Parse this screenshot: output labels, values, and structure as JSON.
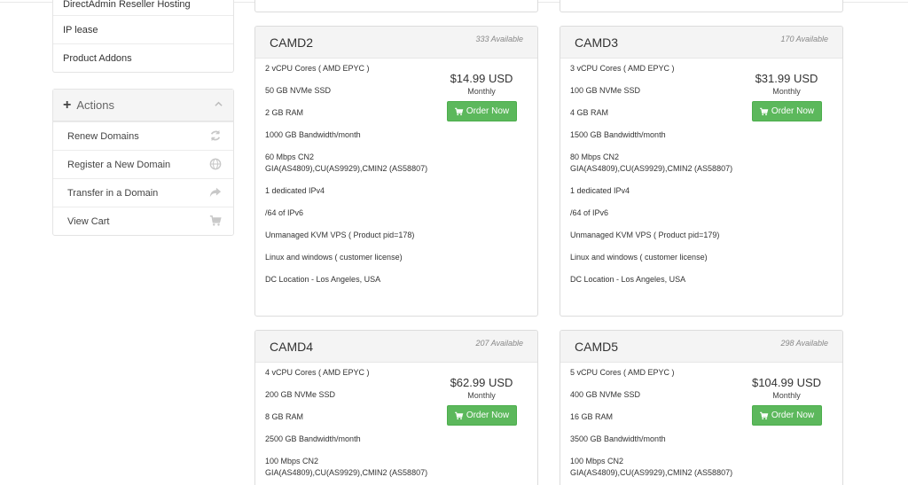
{
  "sidebar": {
    "items": [
      {
        "label": "DirectAdmin Reseller Hosting"
      },
      {
        "label": "IP lease"
      },
      {
        "label": "Product Addons"
      }
    ]
  },
  "actions": {
    "title": "Actions",
    "items": [
      {
        "label": "Renew Domains",
        "icon": "refresh-icon"
      },
      {
        "label": "Register a New Domain",
        "icon": "globe-icon"
      },
      {
        "label": "Transfer in a Domain",
        "icon": "share-icon"
      },
      {
        "label": "View Cart",
        "icon": "cart-icon"
      }
    ]
  },
  "products": [
    {
      "name": "CAMD2",
      "available": "333 Available",
      "price": "$14.99 USD",
      "cycle": "Monthly",
      "order_label": "Order Now",
      "features": [
        "2 vCPU Cores ( AMD EPYC )",
        "50 GB NVMe SSD",
        "2 GB RAM",
        "1000 GB Bandwidth/month",
        "60 Mbps CN2 GIA(AS4809),CU(AS9929),CMIN2 (AS58807)",
        "1 dedicated IPv4",
        "/64 of IPv6",
        "Unmanaged KVM VPS ( Product pid=178)",
        "Linux and windows ( customer license)",
        "DC Location - Los Angeles, USA"
      ]
    },
    {
      "name": "CAMD3",
      "available": "170 Available",
      "price": "$31.99 USD",
      "cycle": "Monthly",
      "order_label": "Order Now",
      "features": [
        "3 vCPU Cores ( AMD EPYC )",
        "100 GB NVMe SSD",
        "4 GB RAM",
        "1500 GB Bandwidth/month",
        "80 Mbps CN2 GIA(AS4809),CU(AS9929),CMIN2 (AS58807)",
        "1 dedicated IPv4",
        "/64 of IPv6",
        "Unmanaged KVM VPS ( Product pid=179)",
        "Linux and windows ( customer license)",
        "DC Location - Los Angeles, USA"
      ]
    },
    {
      "name": "CAMD4",
      "available": "207 Available",
      "price": "$62.99 USD",
      "cycle": "Monthly",
      "order_label": "Order Now",
      "features": [
        "4 vCPU Cores ( AMD EPYC )",
        "200 GB NVMe SSD",
        "8 GB RAM",
        "2500 GB Bandwidth/month",
        "100 Mbps CN2 GIA(AS4809),CU(AS9929),CMIN2 (AS58807)"
      ]
    },
    {
      "name": "CAMD5",
      "available": "298 Available",
      "price": "$104.99 USD",
      "cycle": "Monthly",
      "order_label": "Order Now",
      "features": [
        "5 vCPU Cores ( AMD EPYC )",
        "400 GB NVMe SSD",
        "16 GB RAM",
        "3500 GB Bandwidth/month",
        "100 Mbps CN2 GIA(AS4809),CU(AS9929),CMIN2 (AS58807)"
      ]
    }
  ],
  "colors": {
    "order_button": "#5cb85c",
    "panel_header": "#f4f4f4",
    "border": "#dcdcdc"
  }
}
